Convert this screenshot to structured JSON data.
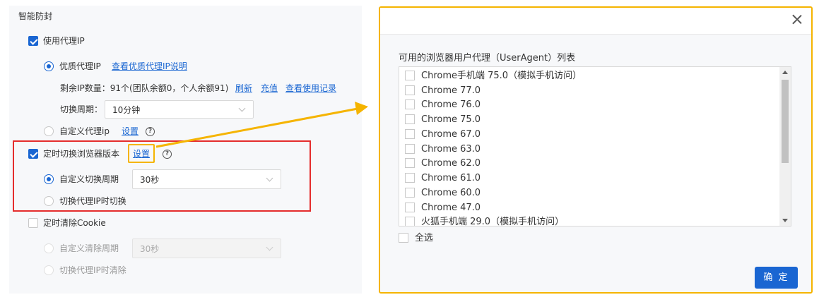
{
  "settings": {
    "section_title": "智能防封",
    "use_proxy_label": "使用代理IP",
    "quality_proxy_label": "优质代理IP",
    "quality_proxy_link": "查看优质代理IP说明",
    "remaining_ip_text": "剩余IP数量：91个(团队余额0，个人余额91)",
    "refresh_link": "刷新",
    "recharge_link": "充值",
    "usage_log_link": "查看使用记录",
    "switch_period_label": "切换周期：",
    "switch_period_value": "10分钟",
    "custom_proxy_label": "自定义代理ip",
    "custom_proxy_setting_link": "设置",
    "timed_browser_switch_label": "定时切换浏览器版本",
    "timed_browser_switch_setting_link": "设置",
    "custom_switch_period_label": "自定义切换周期",
    "custom_switch_period_value": "30秒",
    "switch_on_ip_change_label": "切换代理IP时切换",
    "timed_clear_cookie_label": "定时清除Cookie",
    "custom_clear_period_label": "自定义清除周期",
    "custom_clear_period_value": "30秒",
    "clear_on_ip_change_label": "切换代理IP时清除",
    "help_glyph": "?"
  },
  "dialog": {
    "list_title": "可用的浏览器用户代理（UserAgent）列表",
    "user_agents": [
      "Chrome手机端 75.0（模拟手机访问）",
      "Chrome 77.0",
      "Chrome 76.0",
      "Chrome 75.0",
      "Chrome 67.0",
      "Chrome 63.0",
      "Chrome 62.0",
      "Chrome 61.0",
      "Chrome 60.0",
      "Chrome 47.0",
      "火狐手机端 29.0（模拟手机访问）"
    ],
    "select_all_label": "全选",
    "confirm_button": "确 定"
  },
  "colors": {
    "accent": "#1a66d2",
    "highlight_red": "#e52d2d",
    "highlight_yellow": "#f5b400"
  }
}
